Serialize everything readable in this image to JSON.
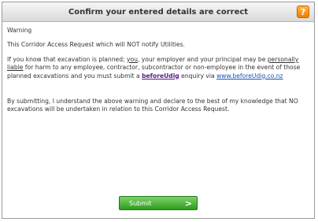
{
  "dialog": {
    "title": "Confirm your entered details are correct",
    "help_label": "?"
  },
  "content": {
    "warning_heading": "Warning",
    "notice": "This Corridor Access Request which will NOT notify Utilities.",
    "para2_part1": "If you know that excavation is planned; ",
    "para2_you": "you",
    "para2_part2": ", your employer and your principal may be ",
    "para2_liable": "personally liable",
    "para2_part3": " for harm to any employee, contractor, subcontractor or non-employee in the event of those planned excavations and you must submit a ",
    "beforeudig_label": "beforeUdig",
    "para2_part4": " enquiry via ",
    "beforeudig_url": "www.beforeUdig.co.nz",
    "declaration": "By submitting, I understand the above warning and declare to the best of my knowledge that NO excavations will be undertaken in relation to this Corridor Access Request."
  },
  "actions": {
    "submit_label": "Submit",
    "submit_arrow": ">"
  }
}
